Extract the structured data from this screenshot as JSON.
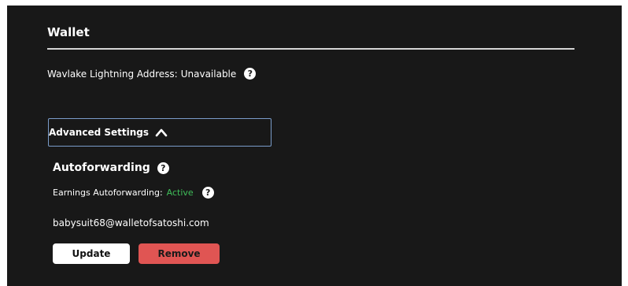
{
  "wallet": {
    "title": "Wallet",
    "lightning_label": "Wavlake Lightning Address:",
    "lightning_value": "Unavailable"
  },
  "advanced": {
    "toggle_label": "Advanced Settings",
    "expanded": true
  },
  "autoforwarding": {
    "title": "Autoforwarding",
    "earnings_label": "Earnings Autoforwarding:",
    "earnings_status": "Active",
    "address": "babysuit68@walletofsatoshi.com",
    "update_label": "Update",
    "remove_label": "Remove"
  },
  "icons": {
    "help": "?"
  },
  "colors": {
    "background": "#181818",
    "active_status": "#3fbf5a",
    "remove_button": "#e05553",
    "toggle_border": "#7a9cc9"
  }
}
